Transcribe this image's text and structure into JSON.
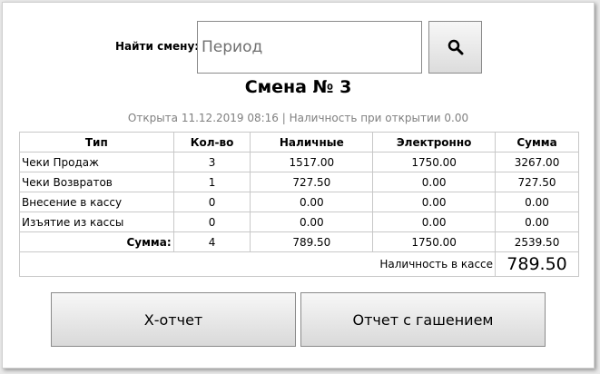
{
  "search": {
    "label": "Найти смену:",
    "placeholder": "Период",
    "value": "",
    "button_icon": "search-icon"
  },
  "shift": {
    "title": "Смена № 3",
    "subtitle": "Открыта 11.12.2019 08:16 | Наличность при открытии 0.00"
  },
  "table": {
    "headers": [
      "Тип",
      "Кол-во",
      "Наличные",
      "Электронно",
      "Сумма"
    ],
    "rows": [
      [
        "Чеки Продаж",
        "3",
        "1517.00",
        "1750.00",
        "3267.00"
      ],
      [
        "Чеки Возвратов",
        "1",
        "727.50",
        "0.00",
        "727.50"
      ],
      [
        "Внесение в кассу",
        "0",
        "0.00",
        "0.00",
        "0.00"
      ],
      [
        "Изъятие из кассы",
        "0",
        "0.00",
        "0.00",
        "0.00"
      ]
    ],
    "total": {
      "label": "Сумма:",
      "count": "4",
      "cash": "789.50",
      "electronic": "1750.00",
      "sum": "2539.50"
    },
    "cash_in_register": {
      "label": "Наличность в кассе",
      "value": "789.50"
    }
  },
  "actions": {
    "x_report": "Х-отчет",
    "z_report": "Отчет с гашением"
  }
}
